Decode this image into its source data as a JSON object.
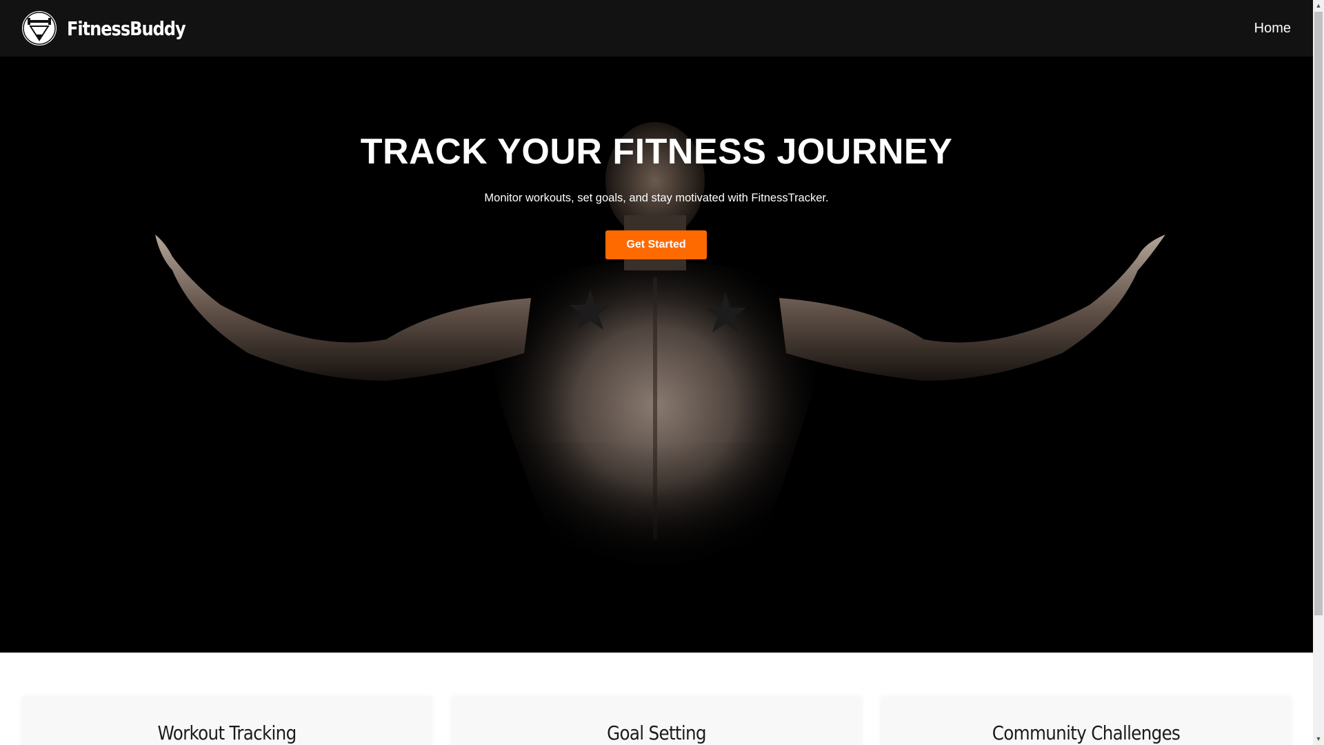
{
  "navbar": {
    "brand_name": "FitnessBuddy",
    "logo_text": "FITNESS",
    "links": [
      {
        "label": "Home"
      }
    ]
  },
  "hero": {
    "title": "TRACK YOUR FITNESS JOURNEY",
    "subtitle": "Monitor workouts, set goals, and stay motivated with FitnessTracker.",
    "cta_label": "Get Started"
  },
  "features": [
    {
      "title": "Workout Tracking"
    },
    {
      "title": "Goal Setting"
    },
    {
      "title": "Community Challenges"
    }
  ],
  "colors": {
    "navbar_bg": "#121212",
    "hero_bg": "#000000",
    "accent": "#ff6a00",
    "card_bg": "#f8f8f8"
  },
  "icons": {
    "scroll_up": "▲",
    "scroll_down": "▼"
  }
}
